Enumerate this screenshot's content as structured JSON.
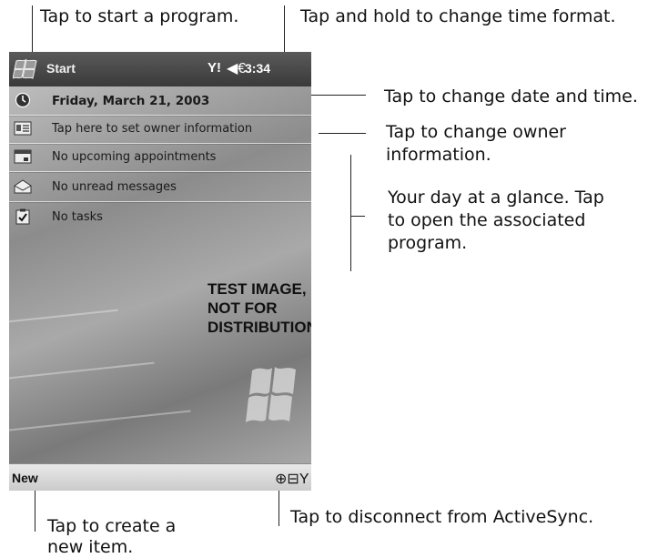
{
  "callouts": {
    "start_program": "Tap to start a program.",
    "time_format": "Tap and hold to change time format.",
    "date_time": "Tap to change date and time.",
    "owner_info_line1": "Tap to change owner",
    "owner_info_line2": "information.",
    "glance_line1": "Your day at a glance. Tap",
    "glance_line2": "to open the associated",
    "glance_line3": "program.",
    "new_item_line1": "Tap to create a",
    "new_item_line2": "new item.",
    "activesync": "Tap to disconnect from ActiveSync."
  },
  "device": {
    "titlebar": {
      "start_label": "Start",
      "signal": "Y!",
      "speaker": "◀€",
      "clock": "3:34"
    },
    "today": {
      "date": "Friday, March 21, 2003",
      "owner": "Tap here to set owner information",
      "appointments": "No upcoming appointments",
      "messages": "No unread messages",
      "tasks": "No tasks"
    },
    "watermark": [
      "TEST IMAGE,",
      "NOT FOR",
      "DISTRIBUTION"
    ],
    "bottombar": {
      "new_label": "New",
      "tray": "⊕⊟Y"
    }
  },
  "icons": {
    "start": "windows-flag-icon",
    "date": "clock-icon",
    "owner": "owner-card-icon",
    "appointments": "calendar-icon",
    "messages": "envelope-icon",
    "tasks": "checklist-icon"
  }
}
